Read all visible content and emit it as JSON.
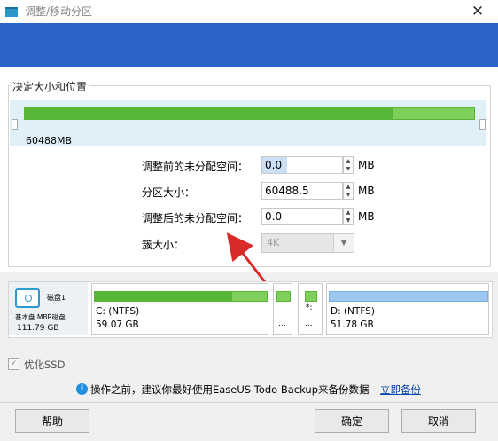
{
  "window": {
    "title": "调整/移动分区",
    "close_glyph": "✕"
  },
  "group_title": "决定大小和位置",
  "size_bar": {
    "label": "60488MB",
    "fill_fraction": 0.82,
    "color_dark": "#56b637",
    "color_light": "#7fd05a"
  },
  "form": {
    "unalloc_before": {
      "label": "调整前的未分配空间：",
      "value": "0.0",
      "unit": "MB"
    },
    "partition_size": {
      "label": "分区大小：",
      "value": "60488.5",
      "unit": "MB"
    },
    "unalloc_after": {
      "label": "调整后的未分配空间：",
      "value": "0.0",
      "unit": "MB"
    },
    "cluster_size": {
      "label": "簇大小：",
      "value": "4K"
    }
  },
  "disk": {
    "name": "磁盘1",
    "type": "基本盘 MBR磁盘",
    "size": "111.79 GB",
    "partitions": [
      {
        "name": "C: (NTFS)",
        "size": "59.07 GB"
      },
      {
        "name": "*:",
        "size": "..."
      },
      {
        "name": "D: (NTFS)",
        "size": "51.78 GB"
      }
    ],
    "small_label": "..."
  },
  "options": {
    "optimize_ssd_label": "优化SSD",
    "checked": true
  },
  "info": {
    "text": "操作之前，建议你最好使用EaseUS Todo Backup来备份数据",
    "link": "立即备份"
  },
  "buttons": {
    "help": "帮助",
    "ok": "确定",
    "cancel": "取消"
  },
  "colors": {
    "banner": "#2b64c9",
    "accent_blue": "#1f8fe0",
    "arrow_red": "#d92a2a"
  }
}
